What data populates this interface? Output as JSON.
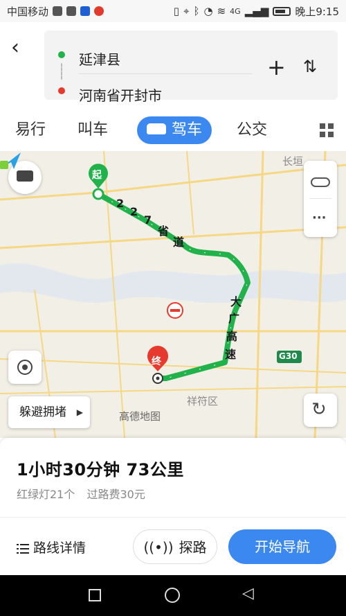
{
  "status": {
    "carrier": "中国移动",
    "time": "晚上9:15",
    "signal": "4G",
    "badge_text": "吧"
  },
  "route": {
    "start": "延津县",
    "end": "河南省开封市"
  },
  "tabs": [
    {
      "label": "易行"
    },
    {
      "label": "叫车"
    },
    {
      "label": "驾车"
    },
    {
      "label": "公交"
    }
  ],
  "map": {
    "labels": {
      "changyuan": "长垣",
      "xiangfu": "祥符区",
      "g30": "G30",
      "start_marker": "起",
      "end_marker": "终"
    },
    "road_227": [
      "2",
      "2",
      "7",
      "省",
      "道"
    ],
    "road_daguang": [
      "大",
      "广",
      "高",
      "速"
    ],
    "avoid_label": "躲避拥堵",
    "gaode": "高德地图"
  },
  "summary": {
    "duration_distance": "1小时30分钟  73公里",
    "lights": "红绿灯21个",
    "toll": "过路费30元"
  },
  "actions": {
    "details": "路线详情",
    "explore": "探路",
    "navigate": "开始导航"
  },
  "colors": {
    "accent": "#3b88f0",
    "route": "#22b24c",
    "start_dot": "#22b24c",
    "end_dot": "#e63a2e"
  }
}
